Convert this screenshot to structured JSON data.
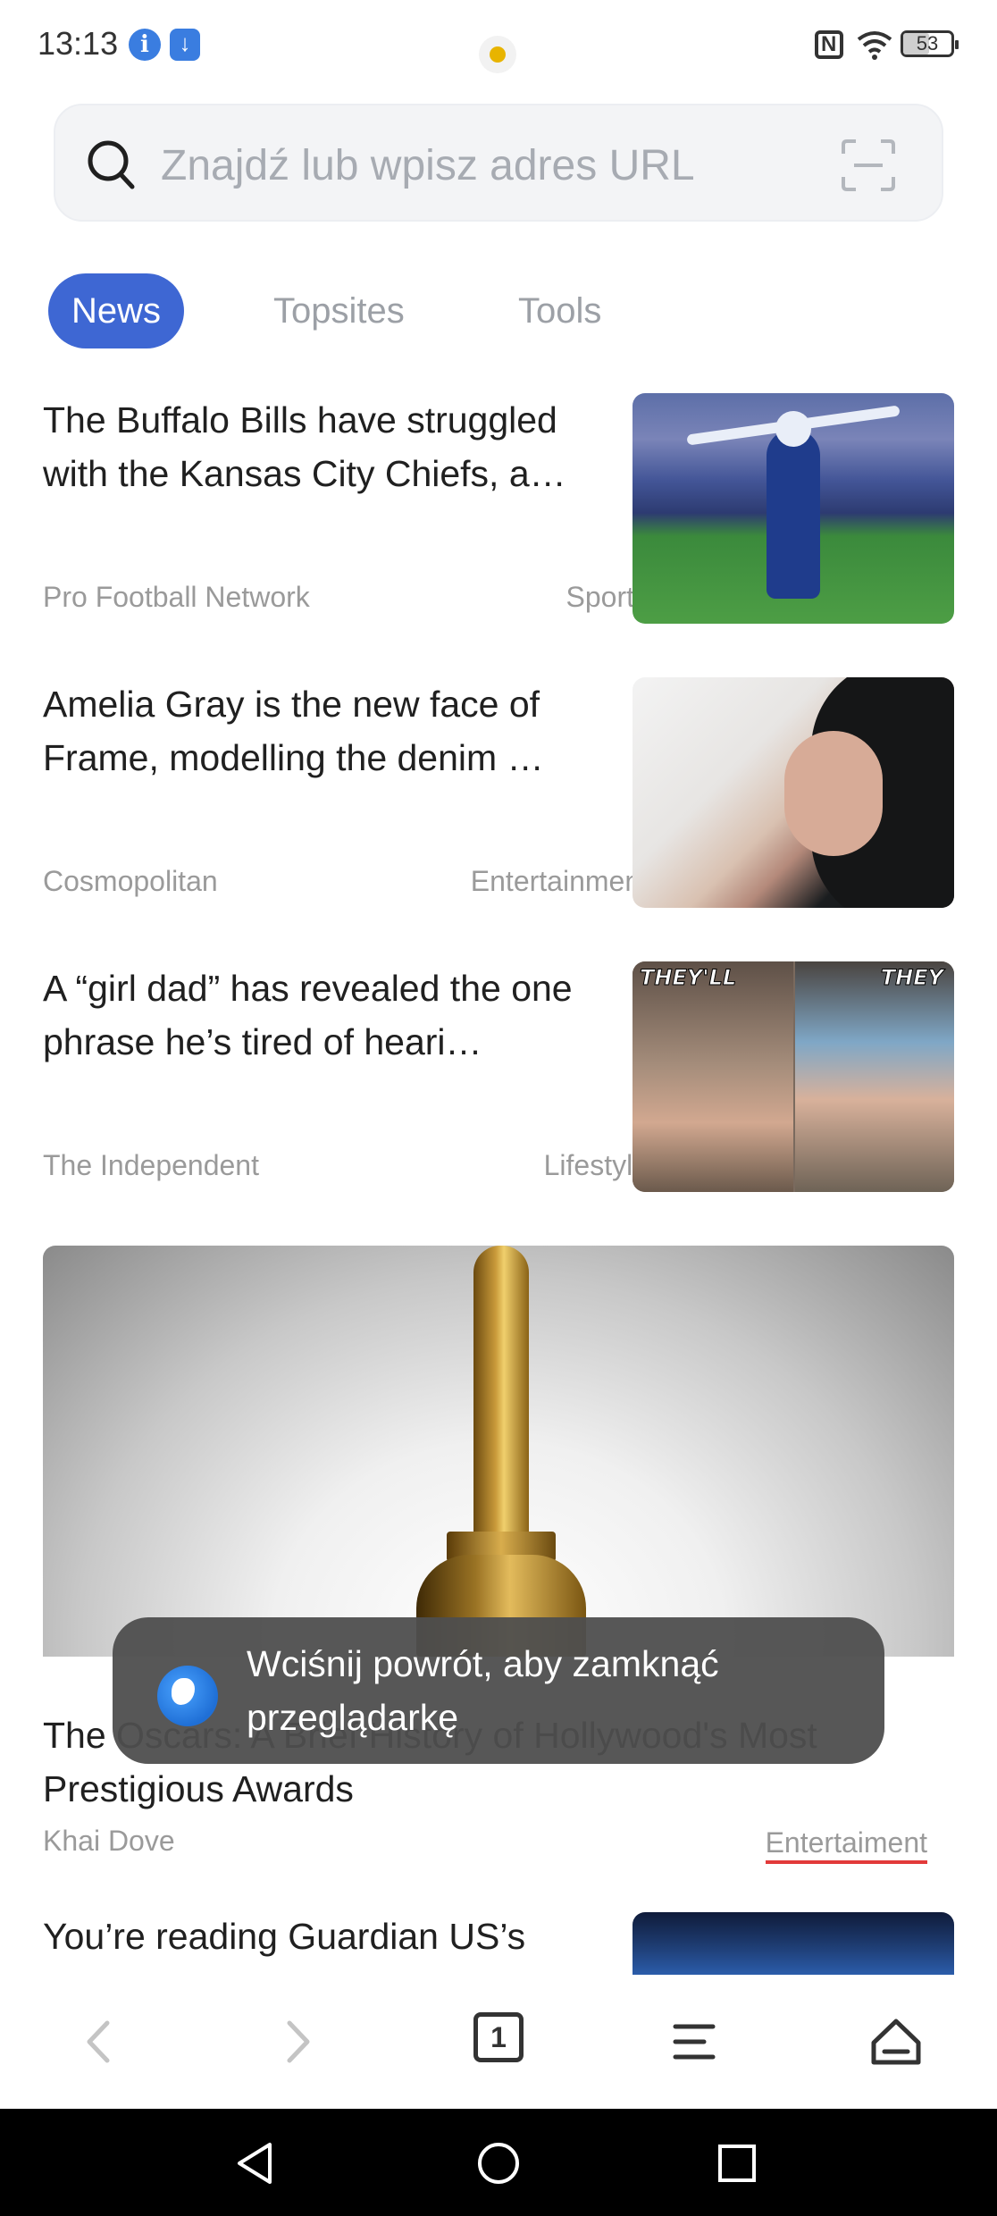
{
  "status_bar": {
    "time": "13:13",
    "battery": "53",
    "battery_level": 0.53
  },
  "search": {
    "placeholder": "Znajdź lub wpisz adres URL"
  },
  "tabs": [
    {
      "label": "News",
      "active": true
    },
    {
      "label": "Topsites",
      "active": false
    },
    {
      "label": "Tools",
      "active": false
    }
  ],
  "articles": [
    {
      "title": "The Buffalo Bills have struggled with the Kansas City Chiefs, a…",
      "source": "Pro Football Network",
      "category": "Sports"
    },
    {
      "title": "Amelia Gray is the new face of Frame, modelling the denim …",
      "source": "Cosmopolitan",
      "category": "Entertainment"
    },
    {
      "title": "A “girl dad” has revealed the one phrase he’s tired of heari…",
      "source": "The Independent",
      "category": "Lifestyle",
      "thumb_caption_left": "THEY'LL",
      "thumb_caption_right": "THEY"
    }
  ],
  "featured": {
    "title": "The Oscars: A Brief History of Hollywood's Most Prestigious Awards",
    "source": "Khai Dove",
    "category": "Entertaiment"
  },
  "next_article": {
    "title": "You’re reading Guardian US’s"
  },
  "toast": {
    "message": "Wciśnij powrót, aby zamknąć przeglądarkę"
  },
  "toolbar": {
    "tab_count": "1"
  },
  "colors": {
    "accent": "#3e67d3",
    "category_underline": "#e23a3a"
  }
}
